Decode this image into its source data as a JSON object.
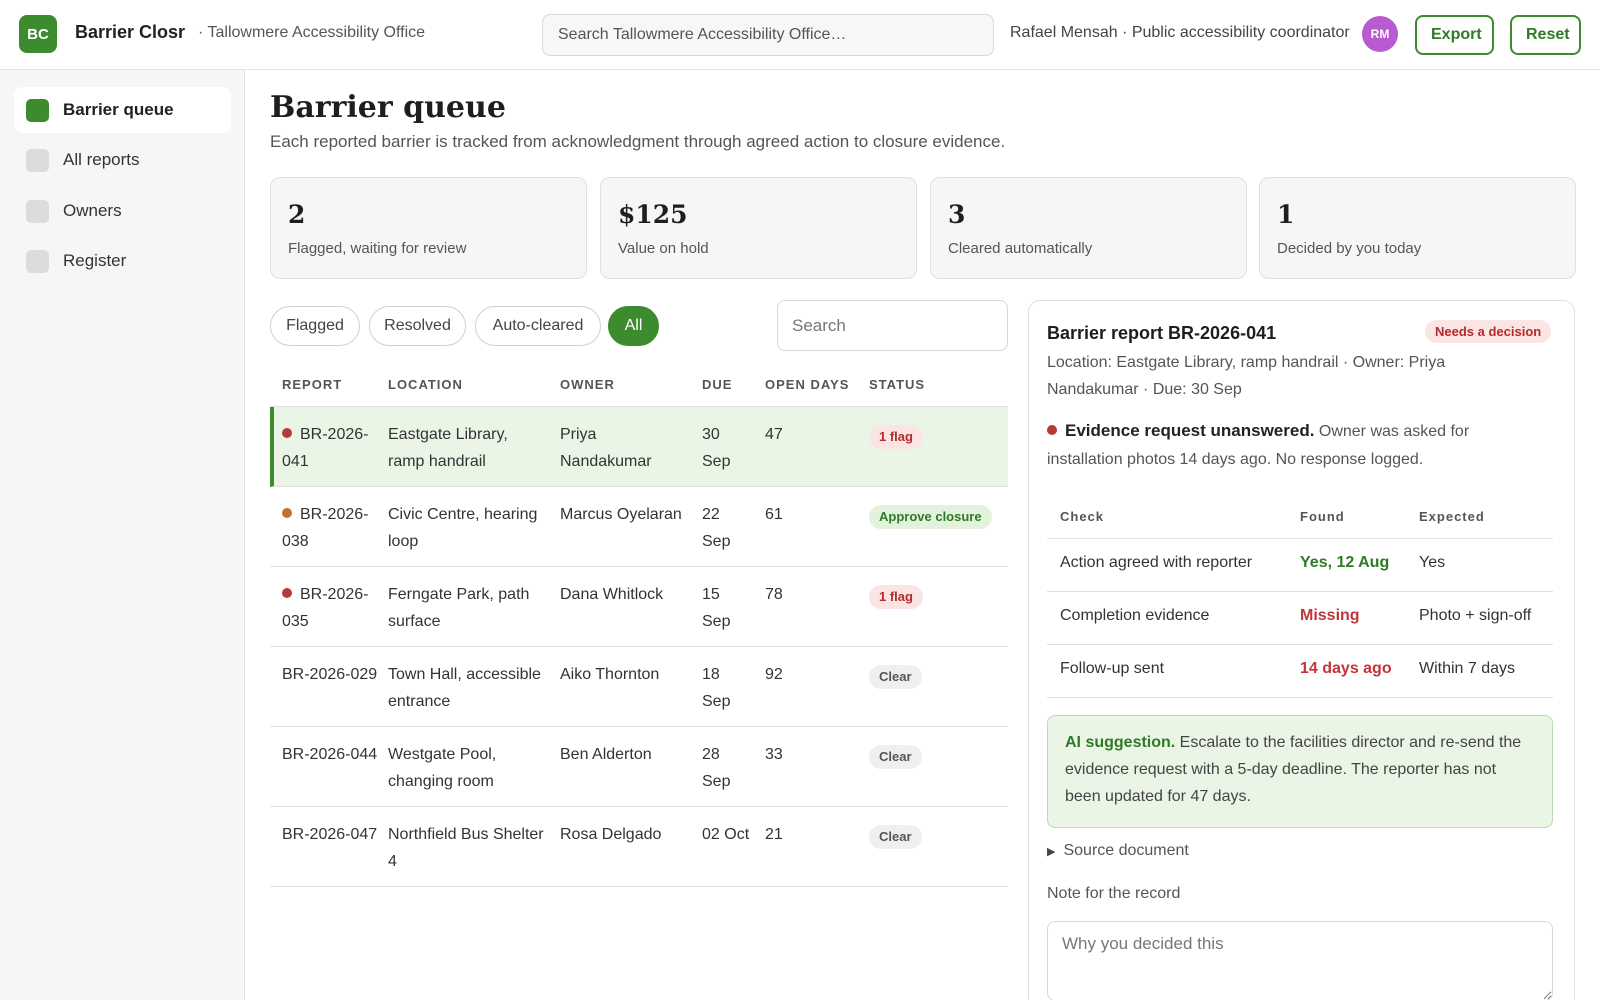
{
  "app": {
    "logo_text": "BC",
    "name": "Barrier Closr",
    "org": "· Tallowmere Accessibility Office",
    "search_placeholder": "Search Tallowmere Accessibility Office…",
    "user": "Rafael Mensah · Public accessibility coordinator",
    "avatar_initials": "RM",
    "export_label": "Export",
    "reset_label": "Reset",
    "accent": "#3d8b2f"
  },
  "sidebar": {
    "items": [
      {
        "label": "Barrier queue",
        "active": true
      },
      {
        "label": "All reports",
        "active": false
      },
      {
        "label": "Owners",
        "active": false
      },
      {
        "label": "Register",
        "active": false
      }
    ]
  },
  "page": {
    "title": "Barrier queue",
    "subtitle": "Each reported barrier is tracked from acknowledgment through agreed action to closure evidence."
  },
  "stats": [
    {
      "value": "2",
      "label": "Flagged, waiting for review"
    },
    {
      "value": "$125",
      "label": "Value on hold"
    },
    {
      "value": "3",
      "label": "Cleared automatically"
    },
    {
      "value": "1",
      "label": "Decided by you today"
    }
  ],
  "filters": {
    "chips": [
      "Flagged",
      "Resolved",
      "Auto-cleared",
      "All"
    ],
    "active": "All",
    "search_placeholder": "Search"
  },
  "table": {
    "columns": [
      "Report",
      "Location",
      "Owner",
      "Due",
      "Open days",
      "Status"
    ],
    "rows": [
      {
        "report": "BR-2026-041",
        "location": "Eastgate Library, ramp handrail",
        "owner": "Priya Nandakumar",
        "due": "30 Sep",
        "open_days": "47",
        "status": "1 flag",
        "status_kind": "flag",
        "dot": "#b53a3a",
        "selected": true
      },
      {
        "report": "BR-2026-038",
        "location": "Civic Centre, hearing loop",
        "owner": "Marcus Oyelaran",
        "due": "22 Sep",
        "open_days": "61",
        "status": "Approve closure",
        "status_kind": "approve",
        "dot": "#c2722a",
        "selected": false
      },
      {
        "report": "BR-2026-035",
        "location": "Ferngate Park, path surface",
        "owner": "Dana Whitlock",
        "due": "15 Sep",
        "open_days": "78",
        "status": "1 flag",
        "status_kind": "flag",
        "dot": "#b53a3a",
        "selected": false
      },
      {
        "report": "BR-2026-029",
        "location": "Town Hall, accessible entrance",
        "owner": "Aiko Thornton",
        "due": "18 Sep",
        "open_days": "92",
        "status": "Clear",
        "status_kind": "clear",
        "dot": "",
        "selected": false
      },
      {
        "report": "BR-2026-044",
        "location": "Westgate Pool, changing room",
        "owner": "Ben Alderton",
        "due": "28 Sep",
        "open_days": "33",
        "status": "Clear",
        "status_kind": "clear",
        "dot": "",
        "selected": false
      },
      {
        "report": "BR-2026-047",
        "location": "Northfield Bus Shelter 4",
        "owner": "Rosa Delgado",
        "due": "02 Oct",
        "open_days": "21",
        "status": "Clear",
        "status_kind": "clear",
        "dot": "",
        "selected": false
      }
    ]
  },
  "status_colors": {
    "flag": {
      "bg": "#fbe4e4",
      "fg": "#b52a2a"
    },
    "approve": {
      "bg": "#e2f2dc",
      "fg": "#2f7a25"
    },
    "clear": {
      "bg": "#efefef",
      "fg": "#555555"
    }
  },
  "detail": {
    "title": "Barrier report BR-2026-041",
    "badge": "Needs a decision",
    "meta": "Location: Eastgate Library, ramp handrail · Owner: Priya Nandakumar · Due: 30 Sep",
    "alert_title": "Evidence request unanswered.",
    "alert_text": " Owner was asked for installation photos 14 days ago. No response logged.",
    "alert_color": "#b53a3a",
    "check_columns": [
      "Check",
      "Found",
      "Expected"
    ],
    "checks": [
      {
        "check": "Action agreed with reporter",
        "found": "Yes, 12 Aug",
        "expected": "Yes",
        "found_color": "#2f7a25"
      },
      {
        "check": "Completion evidence",
        "found": "Missing",
        "expected": "Photo + sign-off",
        "found_color": "#c0353a"
      },
      {
        "check": "Follow-up sent",
        "found": "14 days ago",
        "expected": "Within 7 days",
        "found_color": "#c0353a"
      }
    ],
    "ai_label": "AI suggestion.",
    "ai_text": " Escalate to the facilities director and re-send the evidence request with a 5-day deadline. The reporter has not been updated for 47 days.",
    "source_label": "Source document",
    "note_label": "Note for the record",
    "note_placeholder": "Why you decided this"
  }
}
